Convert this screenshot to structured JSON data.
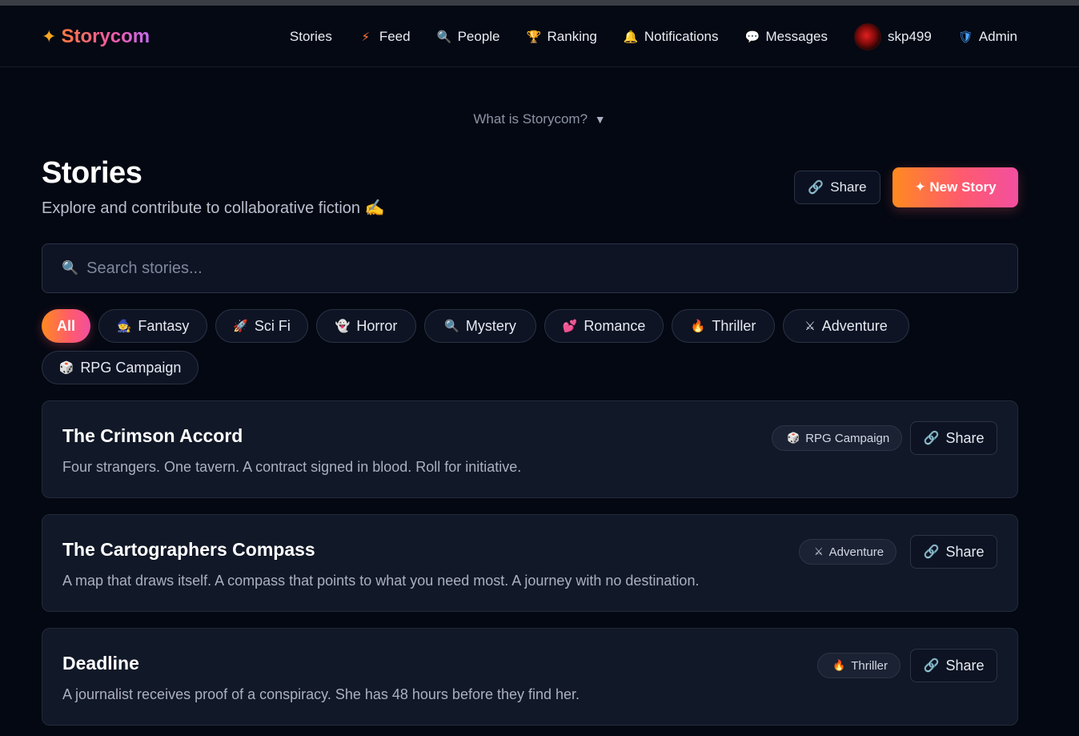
{
  "brand": {
    "icon": "sparkle-icon",
    "name": "Storycom"
  },
  "nav": {
    "items": [
      {
        "label": "Stories",
        "icon": ""
      },
      {
        "label": "Feed",
        "icon": "⚡"
      },
      {
        "label": "People",
        "icon": "🔍"
      },
      {
        "label": "Ranking",
        "icon": "🏆"
      },
      {
        "label": "Notifications",
        "icon": "🔔"
      },
      {
        "label": "Messages",
        "icon": "💬"
      },
      {
        "label": "skp499",
        "icon": "avatar"
      },
      {
        "label": "Admin",
        "icon": "🛡"
      }
    ]
  },
  "whatis": {
    "label": "What is Storycom?",
    "toggle": "▼"
  },
  "header": {
    "title": "Stories",
    "subtitle": "Explore and contribute to collaborative fiction ✍️",
    "share_label": "Share",
    "new_story_label": "✦ New Story"
  },
  "search": {
    "placeholder": "Search stories...",
    "value": ""
  },
  "genres": [
    {
      "label": "All",
      "icon": "",
      "active": true
    },
    {
      "label": "Fantasy",
      "icon": "🧙"
    },
    {
      "label": "Sci Fi",
      "icon": "🚀"
    },
    {
      "label": "Horror",
      "icon": "👻"
    },
    {
      "label": "Mystery",
      "icon": "🔍"
    },
    {
      "label": "Romance",
      "icon": "💕"
    },
    {
      "label": "Thriller",
      "icon": "🔥"
    },
    {
      "label": "Adventure",
      "icon": "⚔"
    },
    {
      "label": "RPG Campaign",
      "icon": "🎲"
    }
  ],
  "stories": [
    {
      "title": "The Crimson Accord",
      "description": "Four strangers. One tavern. A contract signed in blood. Roll for initiative.",
      "tag": "RPG Campaign",
      "tag_icon": "🎲",
      "share_label": "Share"
    },
    {
      "title": "The Cartographers Compass",
      "description": "A map that draws itself. A compass that points to what you need most. A journey with no destination.",
      "tag": "Adventure",
      "tag_icon": "⚔",
      "share_label": "Share"
    },
    {
      "title": "Deadline",
      "description": "A journalist receives proof of a conspiracy. She has 48 hours before they find her.",
      "tag": "Thriller",
      "tag_icon": "🔥",
      "share_label": "Share"
    }
  ],
  "colors": {
    "accent_start": "#ff8a1f",
    "accent_end": "#f24fa0",
    "background": "#040812",
    "card": "#111827"
  }
}
